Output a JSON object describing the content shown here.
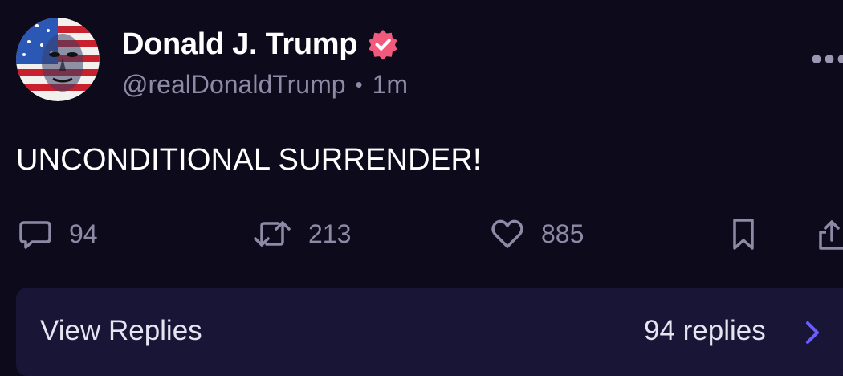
{
  "post": {
    "author": {
      "display_name": "Donald J. Trump",
      "verified": true,
      "handle": "@realDonaldTrump",
      "separator": "•",
      "time_ago": "1m"
    },
    "more_menu_label": "•••",
    "text": "UNCONDITIONAL SURRENDER!",
    "actions": {
      "replies": {
        "count": "94",
        "icon": "comment-icon"
      },
      "reposts": {
        "count": "213",
        "icon": "repost-icon"
      },
      "likes": {
        "count": "885",
        "icon": "heart-icon"
      },
      "bookmark": {
        "icon": "bookmark-icon"
      },
      "share": {
        "icon": "share-icon"
      }
    },
    "replies_bar": {
      "label": "View Replies",
      "count_label": "94 replies",
      "icon": "chevron-right-icon"
    }
  },
  "colors": {
    "background": "#0d0a1c",
    "panel": "#181536",
    "muted_text": "#8e8aa6",
    "verified_badge": "#f25a7d",
    "chevron": "#6a5cff"
  }
}
